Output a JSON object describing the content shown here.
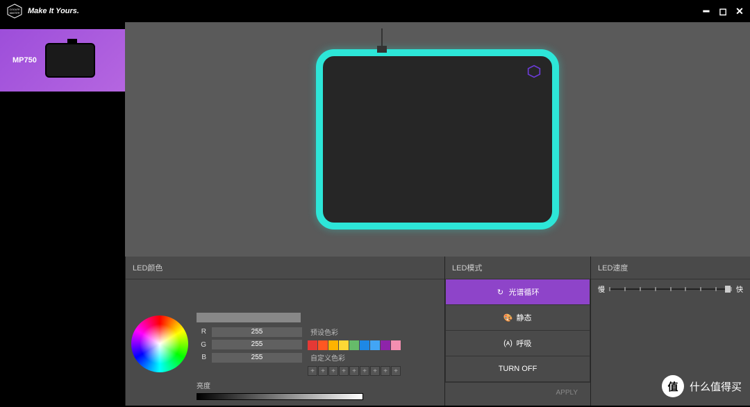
{
  "titlebar": {
    "slogan": "Make It Yours."
  },
  "device": {
    "name": "MP750"
  },
  "preview": {
    "led_color": "#2de6d8"
  },
  "panels": {
    "color": {
      "title": "LED颜色",
      "channels": {
        "r": {
          "label": "R",
          "value": "255"
        },
        "g": {
          "label": "G",
          "value": "255"
        },
        "b": {
          "label": "B",
          "value": "255"
        }
      },
      "preset_label": "预设色彩",
      "custom_label": "自定义色彩",
      "brightness_label": "亮度",
      "preset_colors": [
        "#e53935",
        "#ff5722",
        "#ffb300",
        "#fdd835",
        "#66bb6a",
        "#1e88e5",
        "#42a5f5",
        "#8e24aa",
        "#f48fb1"
      ]
    },
    "mode": {
      "title": "LED模式",
      "items": [
        {
          "label": "光谱循环",
          "active": true
        },
        {
          "label": "静态",
          "active": false
        },
        {
          "label": "呼吸",
          "active": false
        },
        {
          "label": "TURN OFF",
          "active": false
        }
      ],
      "apply_label": "APPLY"
    },
    "speed": {
      "title": "LED速度",
      "slow_label": "慢",
      "fast_label": "快"
    }
  },
  "watermark": {
    "badge": "值",
    "text": "什么值得买"
  }
}
